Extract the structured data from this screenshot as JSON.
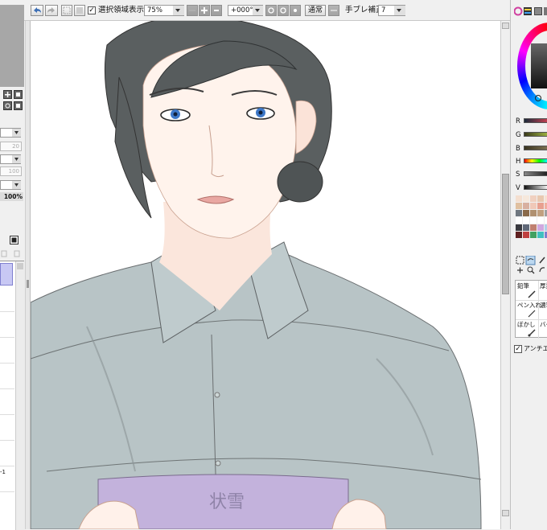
{
  "toolbar": {
    "selection_display_label": "選択領域表示",
    "selection_display_checked": "✓",
    "zoom_value": "75%",
    "rotation_value": "+000°",
    "blend_mode_label": "通常",
    "stabilizer_label": "手ブレ補正",
    "stabilizer_value": "7"
  },
  "left_panel": {
    "field_1": "20",
    "field_2": "100",
    "opacity_value": "100%",
    "layer_name_fragment": "-1"
  },
  "color_panel": {
    "sliders": [
      {
        "label": "R",
        "color": "#3a4a55"
      },
      {
        "label": "G",
        "color": "#4a5a3a"
      },
      {
        "label": "B",
        "color": "#55504a"
      },
      {
        "label": "H",
        "color": "#ff0000"
      },
      {
        "label": "S",
        "color": "#6e6e6e"
      },
      {
        "label": "V",
        "color": "#222222"
      }
    ]
  },
  "tools": {
    "pencil_label": "鉛筆",
    "thick_label": "厚塗",
    "pen_label": "ペン入れ",
    "cover_label": "濃筆",
    "blur_label": "ぼかし",
    "bucket_label": "バケ"
  },
  "antialias": {
    "label": "アンチエイ",
    "checked": "✓"
  },
  "artwork": {
    "document_text": "状雪"
  }
}
